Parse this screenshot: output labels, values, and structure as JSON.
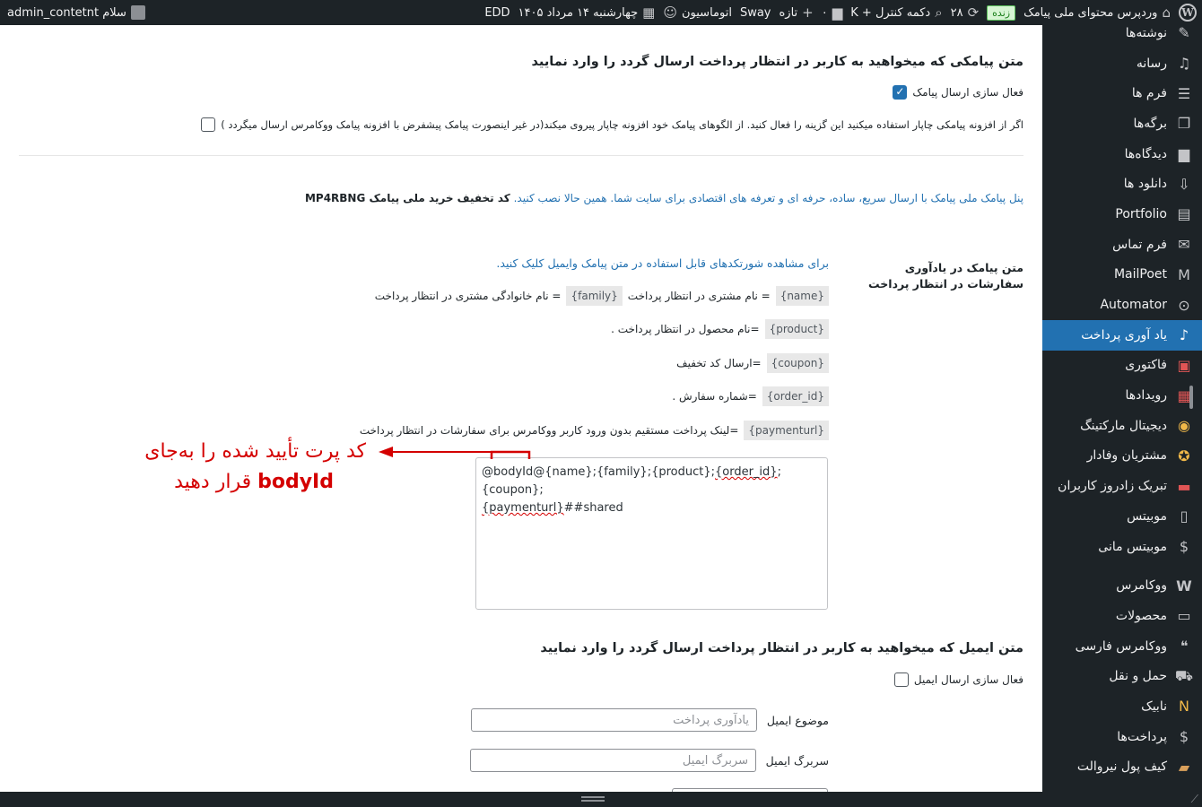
{
  "adminbar": {
    "site_name": "وردپرس محتوای ملی پیامک",
    "live_badge": "زنده",
    "updates_count": "۲۸",
    "control_key": "دکمه کنترل + K",
    "comments_count": "۰",
    "new_label": "تازه",
    "sway_label": "Sway",
    "automation_label": "اتوماسیون",
    "date_label": "چهارشنبه ۱۴ مرداد ۱۴۰۵",
    "edd_label": "EDD",
    "greeting": "سلام admin_contetnt"
  },
  "sidebar": {
    "items": [
      {
        "label": "نوشته‌ها",
        "icon": "pin-icon"
      },
      {
        "label": "رسانه",
        "icon": "media-icon"
      },
      {
        "label": "فرم ها",
        "icon": "forms-icon"
      },
      {
        "label": "برگه‌ها",
        "icon": "pages-icon"
      },
      {
        "label": "دیدگاه‌ها",
        "icon": "comment-icon"
      },
      {
        "label": "دانلود ها",
        "icon": "download-icon"
      },
      {
        "label": "Portfolio",
        "icon": "portfolio-icon"
      },
      {
        "label": "فرم تماس",
        "icon": "mail-icon"
      },
      {
        "label": "MailPoet",
        "icon": "mailpoet-icon"
      },
      {
        "label": "Automator",
        "icon": "automator-icon"
      },
      {
        "label": "یاد آوری پرداخت",
        "icon": "bell-icon"
      },
      {
        "label": "فاکتوری",
        "icon": "invoice-icon"
      },
      {
        "label": "رویدادها",
        "icon": "calendar-icon"
      },
      {
        "label": "دیجیتال مارکتینگ",
        "icon": "megaphone-icon"
      },
      {
        "label": "مشتریان وفادار",
        "icon": "badge-icon"
      },
      {
        "label": "تبریک زادروز کاربران",
        "icon": "gift-icon"
      },
      {
        "label": "موبیتس",
        "icon": "phone-icon"
      },
      {
        "label": "موبیتس مانی",
        "icon": "dollar-icon"
      },
      {
        "label": "ووکامرس",
        "icon": "woocommerce-icon"
      },
      {
        "label": "محصولات",
        "icon": "archive-icon"
      },
      {
        "label": "ووکامرس فارسی",
        "icon": "woo-persian-icon"
      },
      {
        "label": "حمل و نقل",
        "icon": "truck-icon"
      },
      {
        "label": "نابیک",
        "icon": "nabik-icon"
      },
      {
        "label": "پرداخت‌ها",
        "icon": "payment-icon"
      },
      {
        "label": "کیف پول نیروالت",
        "icon": "wallet-icon"
      }
    ]
  },
  "main": {
    "sms_section_title": "متن پیامکی که میخواهید به کاربر در انتظار پرداخت ارسال گردد را وارد نمایید",
    "sms_enable_label": "فعال سازی ارسال پیامک",
    "chapar_label": "اگر از افزونه پیامکی چاپار استفاده میکنید این گزینه را فعال کنید. از الگوهای پیامک خود افزونه چاپار پیروی میکند(در غیر اینصورت پیامک پیشفرض با افزونه پیامک ووکامرس ارسال میگردد )",
    "promo_link_text": "پنل پیامک ملی پیامک با ارسال سریع، ساده، حرفه ای و تعرفه های اقتصادی برای سایت شما. همین حالا نصب کنید.",
    "promo_code_text": "کد تخفیف خرید ملی پیامک MP4RBNG",
    "reminder_label": "متن پیامک در یادآوری سفارشات در انتظار پرداخت",
    "shortcodes_link": "برای مشاهده شورتکدهای قابل استفاده در متن پیامک وایمیل کلیک کنید.",
    "shortcodes": {
      "name_code": "{name}",
      "name_desc": "= نام مشتری در انتظار پرداخت",
      "family_code": "{family}",
      "family_desc": "= نام خانوادگی مشتری در انتظار پرداخت",
      "product_code": "{product}",
      "product_desc": "=نام محصول در انتظار پرداخت .",
      "coupon_code": "{coupon}",
      "coupon_desc": "=ارسال کد تخفیف",
      "order_code": "{order_id}",
      "order_desc": "=شماره سفارش .",
      "payment_code": "{paymenturl}",
      "payment_desc": "=لینک پرداخت مستقیم بدون ورود کاربر ووکامرس برای سفارشات در انتظار پرداخت"
    },
    "sms_text": {
      "prefix": "@bodyId@{name};{family};{product};",
      "order_id": "{order_id}",
      "after_order": ";{coupon};",
      "paymenturl": "{paymenturl}",
      "suffix": "##shared"
    },
    "annotation_line1": "کد پرت تأیید شده را به‌جای",
    "annotation_bold": "bodyId",
    "annotation_rest": "قرار دهید",
    "email_section_title": "متن ایمیل که میخواهید به کاربر در انتظار پرداخت ارسال گردد را وارد نمایید",
    "email_enable_label": "فعال سازی ارسال ایمیل",
    "email_subject_label": "موضوع ایمیل",
    "email_subject_value": "یادآوری پرداخت",
    "email_header_label": "سربرگ ایمیل",
    "email_header_placeholder": "سربرگ ایمیل"
  },
  "colors": {
    "adminbar": "#1d2327",
    "active_menu": "#2271b1",
    "link": "#2271b1",
    "annotation": "#d40000"
  }
}
